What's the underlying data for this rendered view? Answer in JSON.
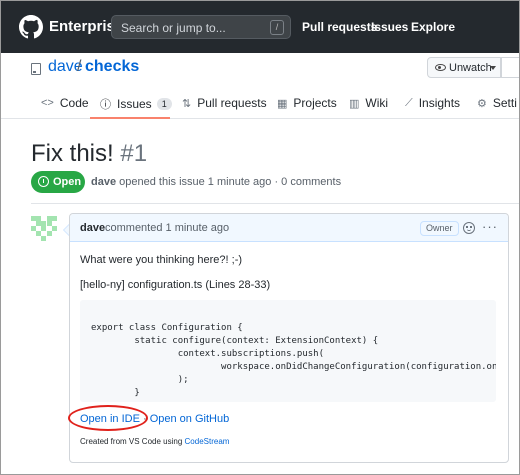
{
  "header": {
    "brand": "Enterprise",
    "search_placeholder": "Search or jump to...",
    "slash_hint": "/",
    "nav": [
      "Pull requests",
      "Issues",
      "Explore"
    ]
  },
  "repo": {
    "owner": "dave",
    "separator": "/",
    "name": "checks",
    "watch_label": "Unwatch"
  },
  "tabs": [
    {
      "icon": "code-icon",
      "glyph": "<>",
      "label": "Code"
    },
    {
      "icon": "issue-icon",
      "glyph": "ⓘ",
      "label": "Issues",
      "count": "1"
    },
    {
      "icon": "pull-request-icon",
      "glyph": "⇅",
      "label": "Pull requests"
    },
    {
      "icon": "projects-icon",
      "glyph": "▦",
      "label": "Projects"
    },
    {
      "icon": "wiki-icon",
      "glyph": "▥",
      "label": "Wiki"
    },
    {
      "icon": "insights-icon",
      "glyph": "⟋",
      "label": "Insights"
    },
    {
      "icon": "settings-icon",
      "glyph": "⚙",
      "label": "Setti"
    }
  ],
  "issue": {
    "title": "Fix this!",
    "number": "#1",
    "state": "Open",
    "author": "dave",
    "meta_text": "opened this issue 1 minute ago · 0 comments"
  },
  "comment": {
    "author": "dave",
    "time": "commented 1 minute ago",
    "role_badge": "Owner",
    "body_line1": "What were you thinking here?! ;-)",
    "body_line2": "[hello-ny] configuration.ts (Lines 28-33)",
    "code_lines": [
      "export class Configuration {",
      "        static configure(context: ExtensionContext) {",
      "                context.subscriptions.push(",
      "                        workspace.onDidChangeConfiguration(configuration.onConfigurat",
      "                );",
      "        }"
    ],
    "link_open_ide": "Open in IDE",
    "link_separator": "·",
    "link_open_github": "Open on GitHub",
    "created_prefix": "Created from VS Code using",
    "created_link": "CodeStream"
  },
  "colors": {
    "header_bg": "#24292e",
    "link": "#0366d6",
    "open_green": "#28a745",
    "tab_underline": "#f9826c",
    "annotation_red": "#e0211b"
  }
}
